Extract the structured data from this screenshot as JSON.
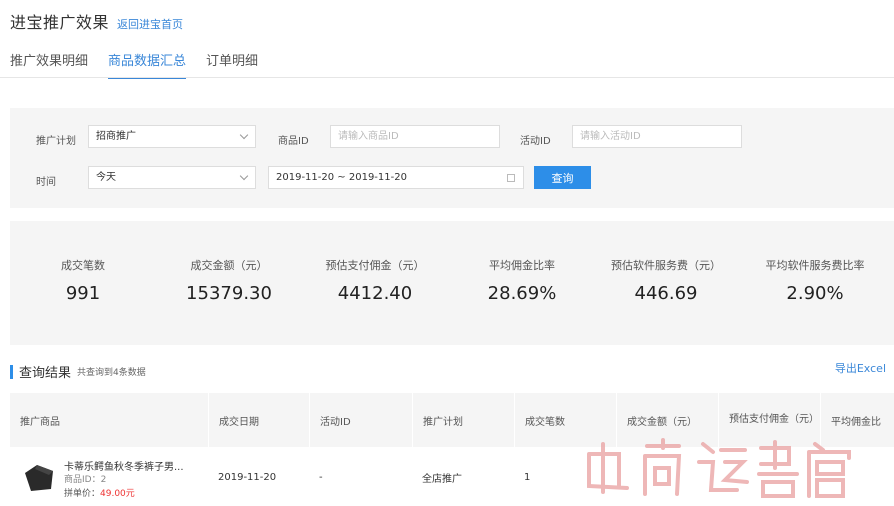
{
  "header": {
    "title": "进宝推广效果",
    "back_link": "返回进宝首页"
  },
  "tabs": [
    {
      "label": "推广效果明细",
      "active": false
    },
    {
      "label": "商品数据汇总",
      "active": true
    },
    {
      "label": "订单明细",
      "active": false
    }
  ],
  "filters": {
    "plan_label": "推广计划",
    "plan_value": "招商推广",
    "product_id_label": "商品ID",
    "product_id_placeholder": "请输入商品ID",
    "activity_id_label": "活动ID",
    "activity_id_placeholder": "请输入活动ID",
    "time_label": "时间",
    "time_value": "今天",
    "date_range": "2019-11-20 ~ 2019-11-20",
    "query_button": "查询"
  },
  "stats": [
    {
      "label": "成交笔数",
      "value": "991"
    },
    {
      "label": "成交金额（元）",
      "value": "15379.30"
    },
    {
      "label": "预估支付佣金（元）",
      "value": "4412.40"
    },
    {
      "label": "平均佣金比率",
      "value": "28.69%"
    },
    {
      "label": "预估软件服务费（元）",
      "value": "446.69"
    },
    {
      "label": "平均软件服务费比率",
      "value": "2.90%"
    }
  ],
  "results": {
    "title": "查询结果",
    "count_text": "共查询到4条数据",
    "export_label": "导出Excel"
  },
  "table": {
    "columns": [
      "推广商品",
      "成交日期",
      "活动ID",
      "推广计划",
      "成交笔数",
      "成交金额（元）",
      "预估支付佣金（元）",
      "平均佣金比"
    ],
    "rows": [
      {
        "product_name": "卡蒂乐鳄鱼秋冬季裤子男...",
        "product_id": "商品ID：2",
        "price_label": "拼单价：",
        "price_value": "49.00元",
        "date": "2019-11-20",
        "activity_id": "-",
        "plan": "全店推广",
        "orders": "1"
      }
    ]
  },
  "watermark": "电商运营官",
  "colors": {
    "accent": "#2d8ee8",
    "price": "#e33333",
    "panel_bg": "#f5f5f5"
  }
}
